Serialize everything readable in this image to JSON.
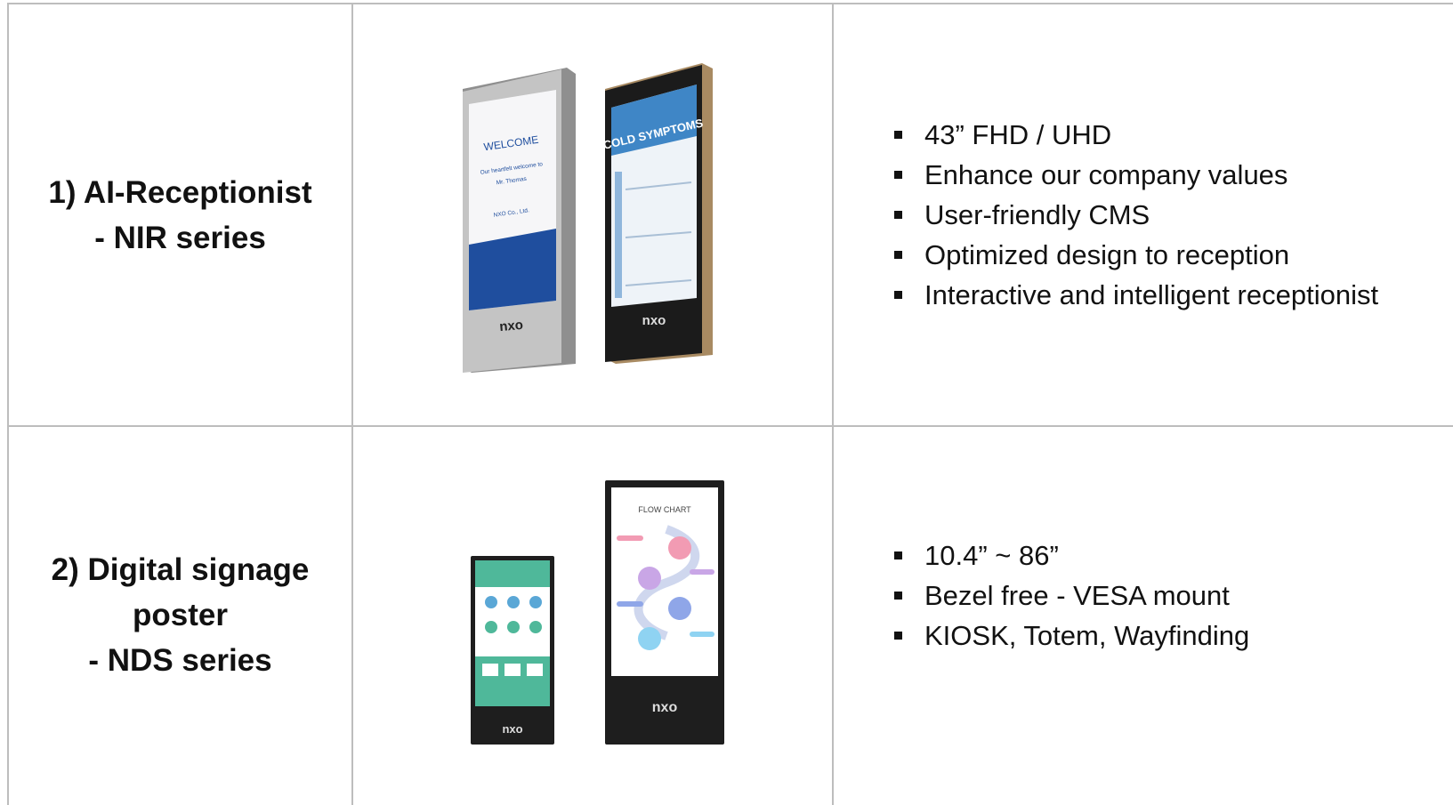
{
  "table": {
    "rows": [
      {
        "name_lines": [
          "1) AI-Receptionist",
          "- NIR series"
        ],
        "device_screens": [
          {
            "title": "WELCOME",
            "sub1": "Our heartfelt welcome to",
            "sub2": "Mr. Thomas",
            "company": "NXO Co., Ltd.",
            "logo": "nxo"
          },
          {
            "title": "COLD SYMPTOMS",
            "logo": "nxo"
          }
        ],
        "specs": [
          "43” FHD / UHD",
          "Enhance our company values",
          "User-friendly CMS",
          "Optimized design to reception",
          "Interactive and intelligent receptionist"
        ]
      },
      {
        "name_lines": [
          "2) Digital signage",
          "poster",
          "- NDS series"
        ],
        "device_screens": [
          {
            "logo": "nxo"
          },
          {
            "title": "FLOW CHART",
            "logo": "nxo"
          }
        ],
        "specs": [
          "10.4” ~  86”",
          "Bezel free - VESA mount",
          "KIOSK, Totem, Wayfinding"
        ]
      }
    ]
  },
  "colors": {
    "grid": "#bdbdbd",
    "blue": "#1f4e9e",
    "teal": "#4fb89a",
    "bezel_dark": "#1b1b1b",
    "bezel_silver": "#b8b8b8"
  }
}
